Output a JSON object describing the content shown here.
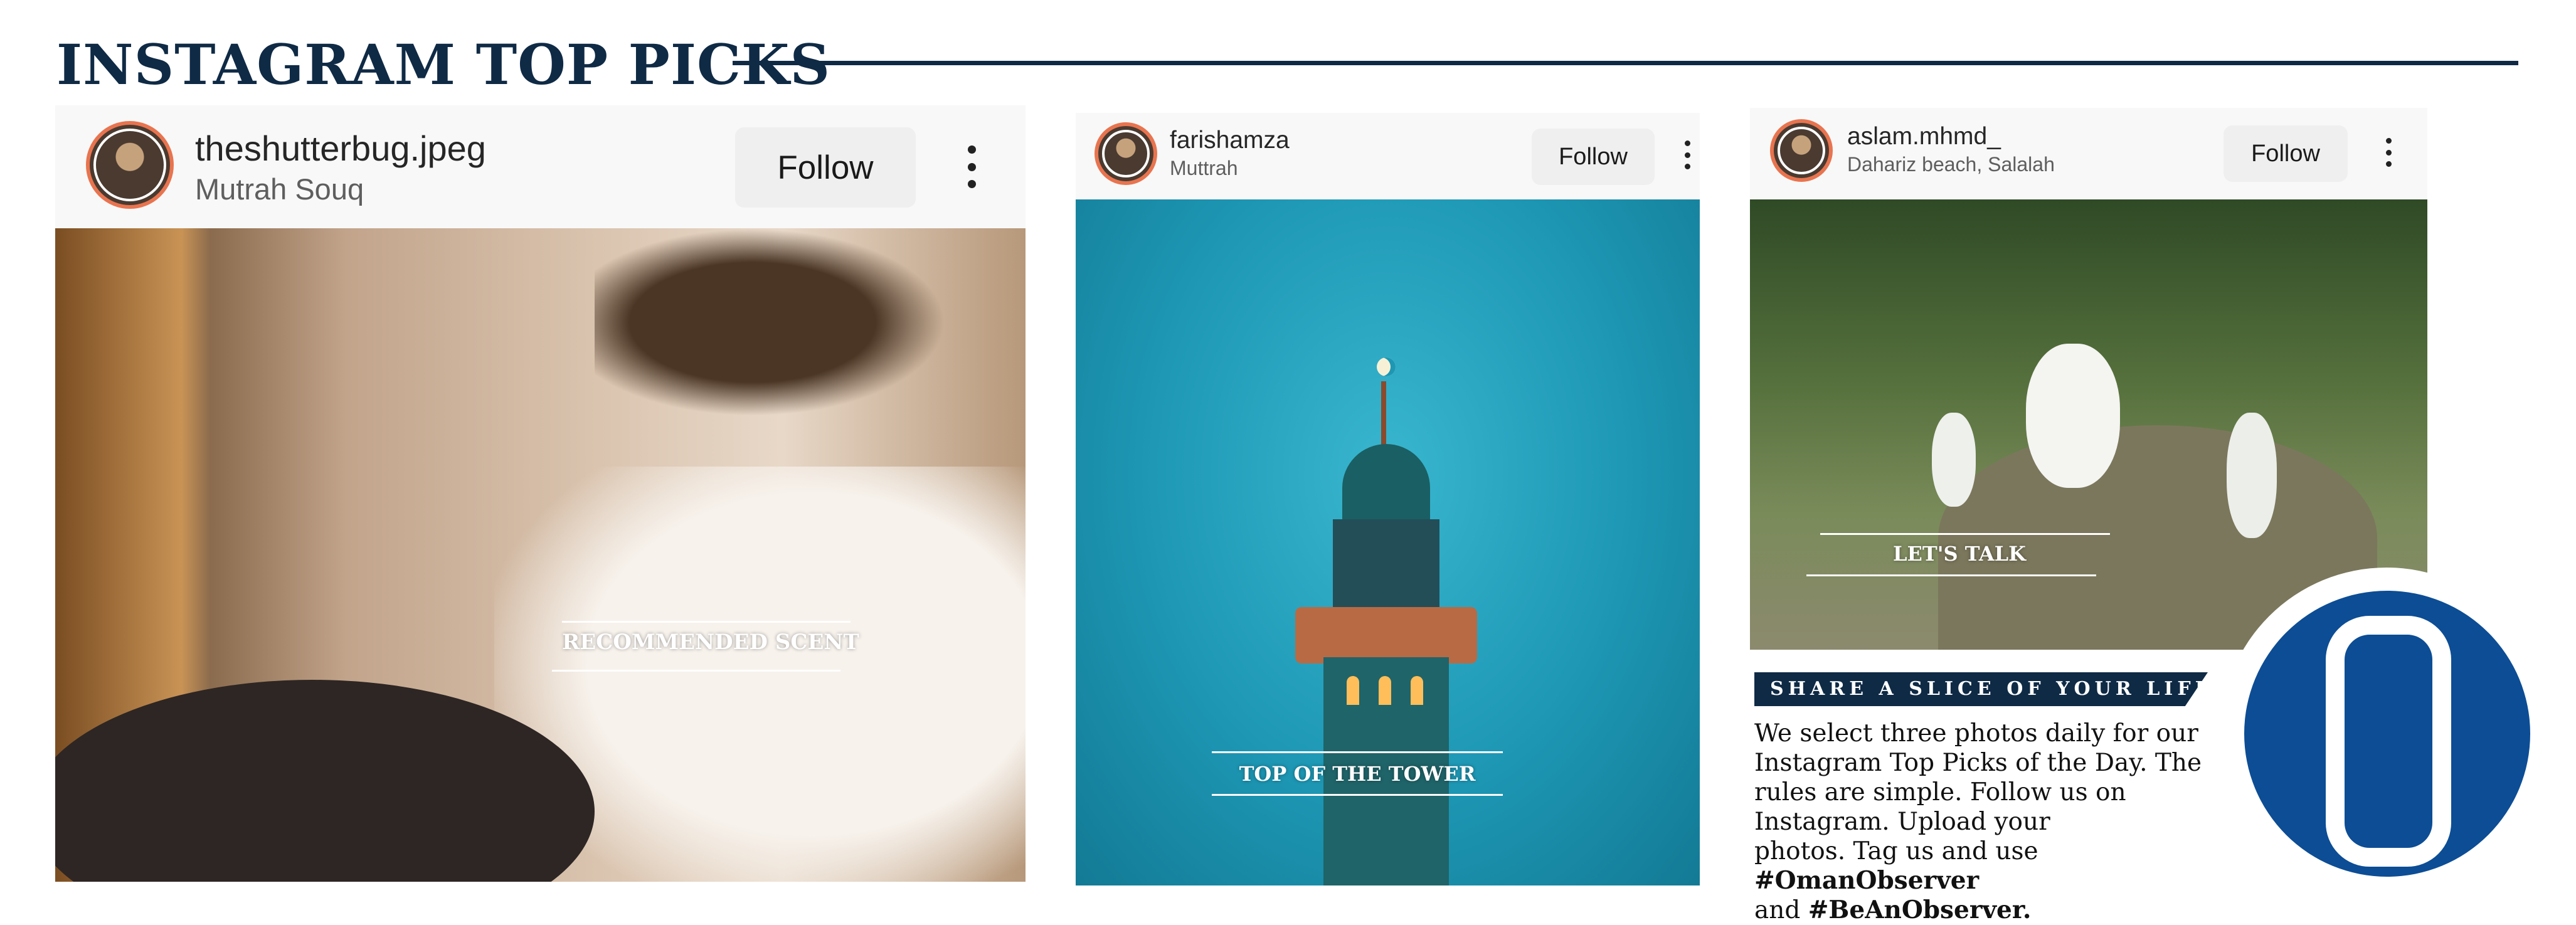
{
  "page": {
    "title": "INSTAGRAM TOP PICKS"
  },
  "posts": [
    {
      "username": "theshutterbug.jpeg",
      "location": "Mutrah Souq",
      "follow_label": "Follow",
      "caption": "RECOMMENDED SCENT"
    },
    {
      "username": "farishamza",
      "location": "Muttrah",
      "follow_label": "Follow",
      "caption": "TOP OF THE TOWER"
    },
    {
      "username": "aslam.mhmd_",
      "location": "Dahariz beach, Salalah",
      "follow_label": "Follow",
      "caption": "LET'S TALK"
    }
  ],
  "promo": {
    "banner": "SHARE A SLICE OF YOUR LIFE",
    "lines": [
      "We select three photos daily for our",
      "Instagram Top Picks of the Day. The",
      "rules are simple. Follow us on",
      "Instagram. Upload your",
      "photos. Tag us and use"
    ],
    "hashtag_1": "#OmanObserver",
    "and_word": "and",
    "hashtag_2": "#BeAnObserver."
  },
  "colors": {
    "navy": "#0f2a45",
    "brand_blue": "#0c4d95",
    "avatar_ring": "#e8744f"
  },
  "icons": [
    "more-vertical-icon",
    "brand-logo-o"
  ]
}
